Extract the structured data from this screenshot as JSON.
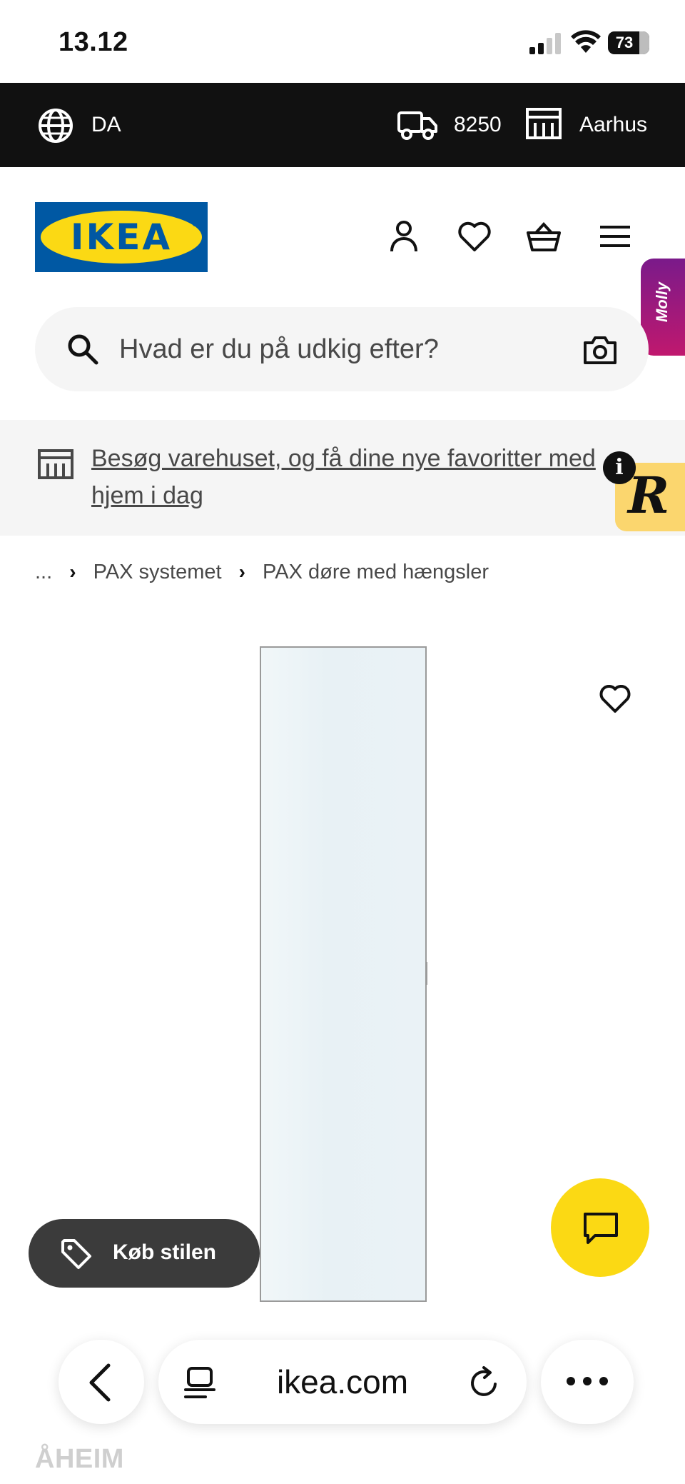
{
  "status_bar": {
    "time": "13.12",
    "battery": "73"
  },
  "locale_bar": {
    "language": "DA",
    "postcode": "8250",
    "store": "Aarhus"
  },
  "header": {
    "logo": "IKEA",
    "molly_tab": "Molly"
  },
  "search": {
    "placeholder": "Hvad er du på udkig efter?"
  },
  "banner": {
    "text": "Besøg varehuset, og få dine nye favoritter med hjem i dag",
    "badge_letter": "R",
    "info": "i"
  },
  "breadcrumb": {
    "ellipsis": "...",
    "items": [
      "PAX systemet",
      "PAX døre med hængsler"
    ]
  },
  "product": {
    "name": "ÅHEIM",
    "buy_style_label": "Køb stilen"
  },
  "browser": {
    "url": "ikea.com"
  },
  "colors": {
    "ikea_blue": "#0058a3",
    "ikea_yellow": "#fbd914",
    "dark_bar": "#111111"
  }
}
